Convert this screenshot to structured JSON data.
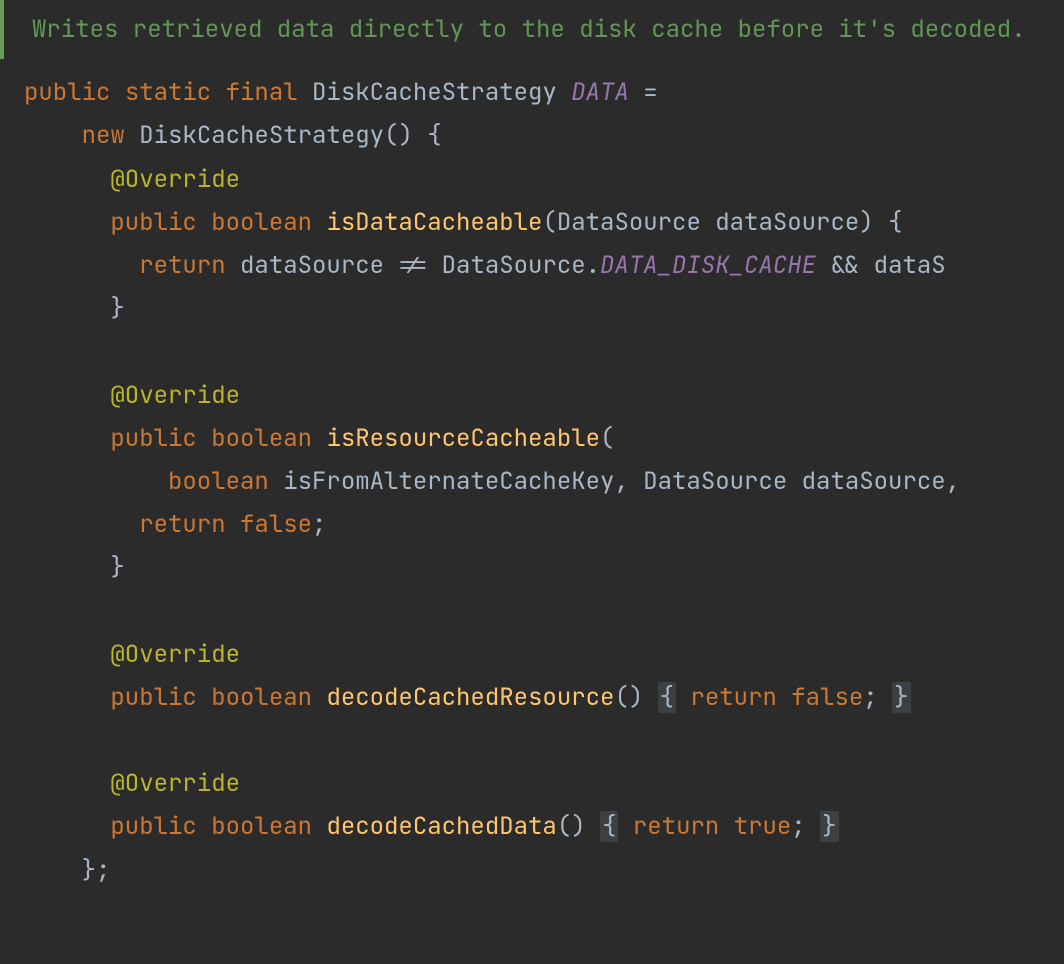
{
  "doc": {
    "text": "Writes retrieved data directly to the disk cache before it's decoded."
  },
  "code": {
    "kw_public": "public",
    "kw_static": "static",
    "kw_final": "final",
    "type_DCS": "DiskCacheStrategy",
    "field_DATA": "DATA",
    "eq": "=",
    "kw_new": "new",
    "paren_open": "(",
    "paren_close": ")",
    "brace_open": "{",
    "brace_close": "}",
    "semi": ";",
    "comma": ",",
    "ann_override": "@Override",
    "kw_boolean": "boolean",
    "m_isDataCacheable": "isDataCacheable",
    "type_DataSource": "DataSource",
    "id_dataSource": "dataSource",
    "kw_return": "return",
    "op_ne": "!=",
    "dot": ".",
    "field_DDC": "DATA_DISK_CACHE",
    "op_and": "&&",
    "id_dataS_cut": "dataS",
    "m_isResourceCacheable": "isResourceCacheable",
    "id_isFromAlt": "isFromAlternateCacheKey",
    "id_dataSource2": "dataSource",
    "kw_false": "false",
    "kw_true": "true",
    "m_decodeCachedResource": "decodeCachedResource",
    "m_decodeCachedData": "decodeCachedData"
  }
}
